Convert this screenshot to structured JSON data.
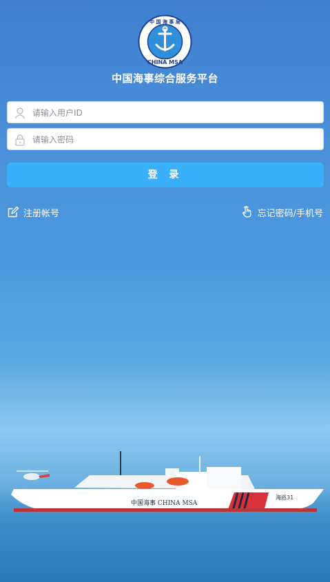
{
  "app": {
    "title": "中国海事综合服务平台",
    "logo_top_text": "中 国 海 事 局",
    "logo_bottom_text": "CHINA MSA"
  },
  "form": {
    "user_id_placeholder": "请输入用户ID",
    "password_placeholder": "请输入密码",
    "login_label": "登 录"
  },
  "links": {
    "register_label": "注册帐号",
    "forgot_label": "忘记密码/手机号"
  },
  "ship": {
    "hull_text": "中国海事 CHINA MSA",
    "hull_number": "海巡31"
  },
  "icons": {
    "user": "user-icon",
    "lock": "lock-icon",
    "edit": "edit-icon",
    "hand": "pointer-hand-icon"
  },
  "colors": {
    "login_button": "#3ab0fb",
    "background_top": "#3f7fcf",
    "text": "#ffffff"
  }
}
